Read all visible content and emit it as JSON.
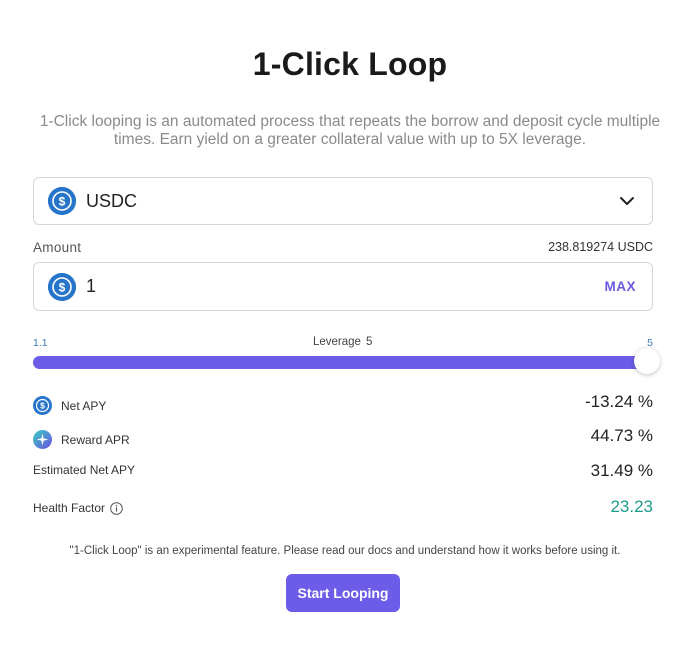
{
  "header": {
    "title": "1-Click Loop",
    "description": "1-Click looping is an automated process that repeats the borrow and deposit cycle multiple times. Earn yield on a greater collateral value with up to 5X leverage."
  },
  "asset_select": {
    "selected": "USDC",
    "icon": "usdc-coin-icon"
  },
  "amount": {
    "label": "Amount",
    "balance": "238.819274 USDC",
    "value": "1",
    "max_label": "MAX"
  },
  "leverage": {
    "min_label": "1.1",
    "label": "Leverage",
    "value": "5",
    "max_label": "5",
    "fraction": 1.0
  },
  "stats": {
    "net_apy": {
      "label": "Net APY",
      "value": "-13.24 %",
      "icon": "usdc-coin-icon"
    },
    "reward_apr": {
      "label": "Reward APR",
      "value": "44.73 %",
      "icon": "reward-token-icon"
    },
    "estimated_net_apy": {
      "label": "Estimated Net APY",
      "value": "31.49 %"
    },
    "health_factor": {
      "label": "Health Factor",
      "value": "23.23",
      "icon": "info-icon"
    }
  },
  "footer": {
    "disclaimer": "\"1-Click Loop\" is an experimental feature. Please read our docs and understand how it works before using it.",
    "button_label": "Start Looping"
  },
  "colors": {
    "accent": "#6c5ce7",
    "usdc": "#2775ca",
    "health_good": "#1e9b8a"
  }
}
